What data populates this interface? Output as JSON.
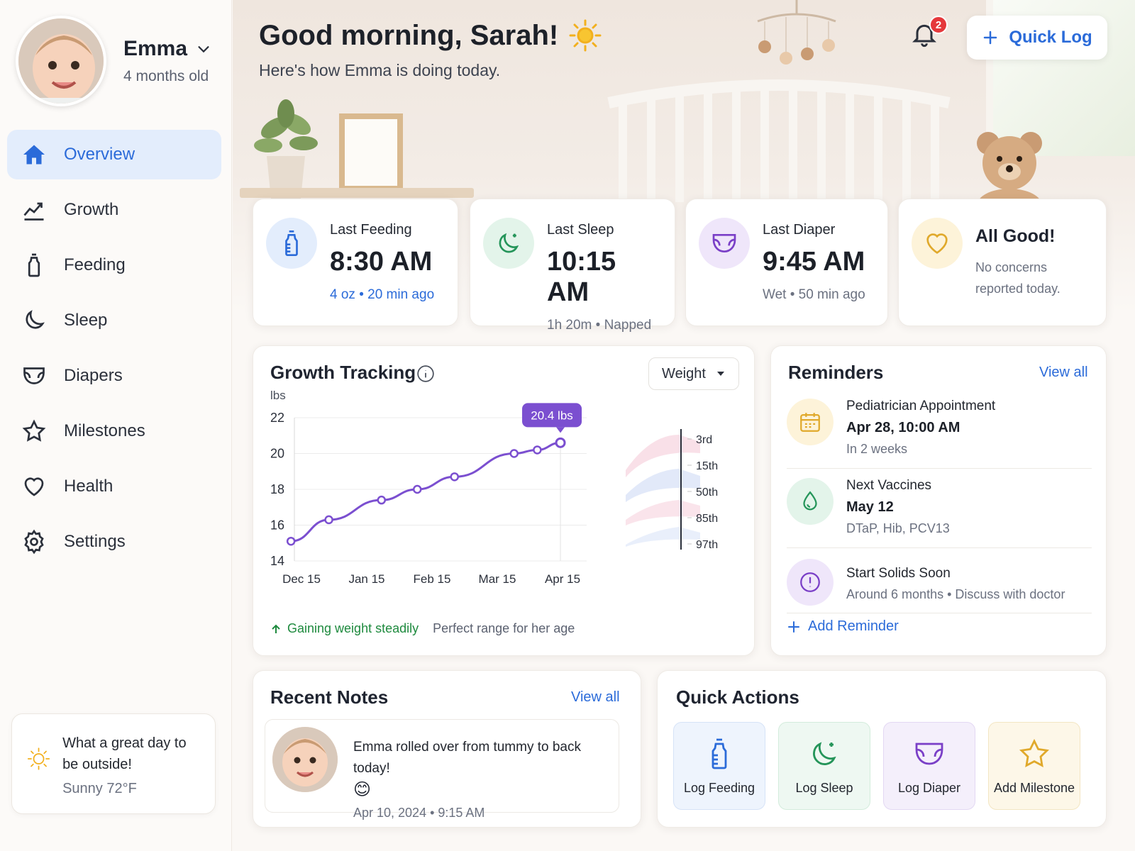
{
  "profile": {
    "name": "Emma",
    "age": "4 months old"
  },
  "nav": [
    {
      "label": "Overview",
      "icon": "home-icon",
      "active": true
    },
    {
      "label": "Growth",
      "icon": "chart-line-icon"
    },
    {
      "label": "Feeding",
      "icon": "bottle-icon"
    },
    {
      "label": "Sleep",
      "icon": "moon-icon"
    },
    {
      "label": "Diapers",
      "icon": "diaper-icon"
    },
    {
      "label": "Milestones",
      "icon": "star-icon"
    },
    {
      "label": "Health",
      "icon": "heart-icon"
    },
    {
      "label": "Settings",
      "icon": "gear-icon"
    }
  ],
  "weather": {
    "message": "What a great day to be outside!",
    "detail": "Sunny 72°F",
    "icon": "sun-icon"
  },
  "header": {
    "greeting": "Good morning, Sarah!",
    "subtitle": "Here's how Emma is doing today.",
    "notification_count": "2",
    "quick_log_label": "Quick Log"
  },
  "stats": {
    "feeding": {
      "label": "Last Feeding",
      "value": "8:30 AM",
      "sub": "4 oz • 20 min ago",
      "icon": "bottle-icon",
      "color": "#e3edfc"
    },
    "sleep": {
      "label": "Last Sleep",
      "value": "10:15 AM",
      "sub": "1h 20m • Napped",
      "icon": "moon-icon",
      "color": "#e3f4ea"
    },
    "diaper": {
      "label": "Last Diaper",
      "value": "9:45 AM",
      "sub": "Wet • 50 min ago",
      "icon": "diaper-icon",
      "color": "#efe6fa"
    },
    "status": {
      "title": "All Good!",
      "sub": "No concerns reported today.",
      "icon": "heart-icon",
      "color": "#fdf3d9"
    }
  },
  "growth": {
    "title": "Growth Tracking",
    "metric": "Weight",
    "unit": "lbs",
    "callout": "20.4 lbs",
    "percentiles": [
      "3rd",
      "15th",
      "50th",
      "85th",
      "97th"
    ],
    "trend": "Gaining weight steadily",
    "range_note": "Perfect range for her age"
  },
  "chart_data": {
    "type": "line",
    "title": "Growth Tracking",
    "ylabel": "lbs",
    "x_ticks": [
      "Dec 15",
      "Jan 15",
      "Feb 15",
      "Mar 15",
      "Apr 15"
    ],
    "y_ticks": [
      14,
      16,
      18,
      20,
      22
    ],
    "ylim": [
      14,
      22
    ],
    "series": [
      {
        "points": [
          {
            "x": "2023-12-10",
            "y": 15.1
          },
          {
            "x": "2023-12-28",
            "y": 16.3
          },
          {
            "x": "2024-01-22",
            "y": 17.4
          },
          {
            "x": "2024-02-08",
            "y": 18.0
          },
          {
            "x": "2024-02-25",
            "y": 18.7
          },
          {
            "x": "2024-03-23",
            "y": 20.0
          },
          {
            "x": "2024-04-03",
            "y": 20.2
          },
          {
            "x": "2024-04-14",
            "y": 20.6
          }
        ]
      }
    ],
    "highlight": {
      "label": "20.4 lbs",
      "point_index": 7
    },
    "grid": true
  },
  "reminders": {
    "title": "Reminders",
    "view_all": "View all",
    "items": [
      {
        "title": "Pediatrician Appointment",
        "when": "Apr 28, 10:00 AM",
        "note": "In 2 weeks",
        "icon": "calendar-icon",
        "color": "#fdf3d9"
      },
      {
        "title": "Next Vaccines",
        "when": "May 12",
        "note": "DTaP, Hib, PCV13",
        "icon": "droplet-icon",
        "color": "#e3f4ea"
      },
      {
        "title": "Start Solids Soon",
        "when": "",
        "note": "Around 6 months • Discuss with doctor",
        "icon": "alert-circle-icon",
        "color": "#efe6fa"
      }
    ],
    "add_label": "Add Reminder"
  },
  "notes": {
    "title": "Recent Notes",
    "view_all": "View all",
    "item": {
      "text": "Emma rolled over from tummy to back today!",
      "emoji": "😊",
      "timestamp": "Apr 10, 2024 • 9:15 AM"
    }
  },
  "quick_actions": {
    "title": "Quick Actions",
    "items": [
      {
        "label": "Log Feeding",
        "icon": "bottle-icon",
        "bg": "#eef4fd",
        "border": "#d6e3f7"
      },
      {
        "label": "Log Sleep",
        "icon": "moon-icon",
        "bg": "#eef8f2",
        "border": "#d3ecdc"
      },
      {
        "label": "Log Diaper",
        "icon": "diaper-icon",
        "bg": "#f4effb",
        "border": "#e3d8f3"
      },
      {
        "label": "Add Milestone",
        "icon": "star-icon",
        "bg": "#fdf7e8",
        "border": "#f3e6c3"
      }
    ]
  }
}
